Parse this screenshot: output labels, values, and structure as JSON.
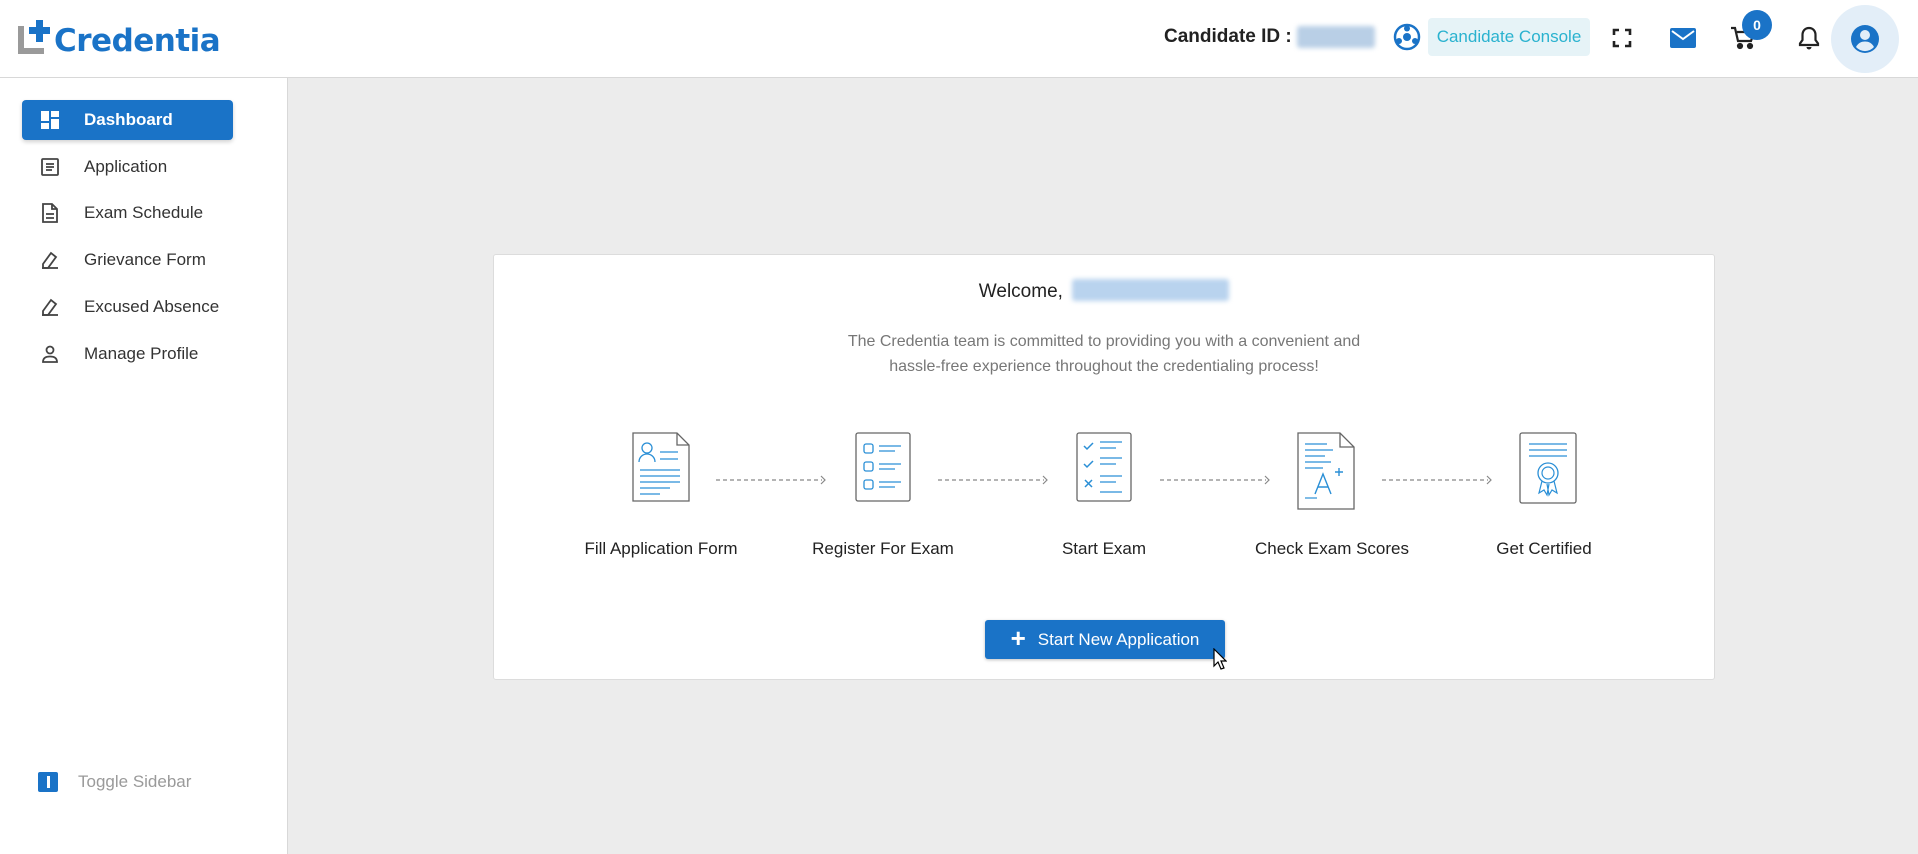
{
  "header": {
    "logo_text": "Credentia",
    "candidate_label": "Candidate ID :",
    "console_button": "Candidate Console",
    "cart_count": "0",
    "brand_color": "#1a73c7"
  },
  "sidebar": {
    "items": [
      {
        "label": "Dashboard",
        "icon": "dashboard-icon",
        "active": true
      },
      {
        "label": "Application",
        "icon": "list-icon"
      },
      {
        "label": "Exam Schedule",
        "icon": "document-icon"
      },
      {
        "label": "Grievance Form",
        "icon": "stamp-icon"
      },
      {
        "label": "Excused Absence",
        "icon": "stamp-icon"
      },
      {
        "label": "Manage Profile",
        "icon": "person-icon"
      }
    ],
    "toggle_label": "Toggle Sidebar"
  },
  "card": {
    "welcome": "Welcome,",
    "description_line1": "The Credentia team is committed to providing you with a convenient and",
    "description_line2": "hassle-free experience throughout the credentialing process!",
    "steps": [
      {
        "label": "Fill Application Form",
        "icon": "application-form-icon"
      },
      {
        "label": "Register For Exam",
        "icon": "checklist-icon"
      },
      {
        "label": "Start Exam",
        "icon": "exam-sheet-icon"
      },
      {
        "label": "Check Exam Scores",
        "icon": "score-sheet-icon"
      },
      {
        "label": "Get Certified",
        "icon": "certificate-icon"
      }
    ],
    "cta_label": "Start New Application"
  }
}
